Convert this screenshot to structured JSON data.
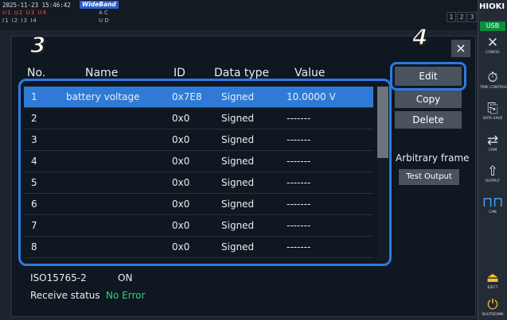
{
  "statusbar": {
    "datetime": "2025-11-23 15:46:42",
    "mode_badge": "WideBand",
    "channel_row1": "U1 U2 U3 U4",
    "channel_row2": "I1 I2 I3 I4",
    "ac_label_top": "A C",
    "ac_label_bottom": "U D",
    "channel_numbers": [
      "1",
      "2",
      "3",
      "4"
    ]
  },
  "dialog": {
    "close_label": "×",
    "step_markers": [
      "3",
      "4"
    ],
    "columns": [
      "No.",
      "Name",
      "ID",
      "Data type",
      "Value"
    ],
    "rows": [
      {
        "no": "1",
        "name": "battery voltage",
        "id": "0x7E8",
        "type": "Signed",
        "value": "10.0000 V"
      },
      {
        "no": "2",
        "name": "",
        "id": "0x0",
        "type": "Signed",
        "value": "-------"
      },
      {
        "no": "3",
        "name": "",
        "id": "0x0",
        "type": "Signed",
        "value": "-------"
      },
      {
        "no": "4",
        "name": "",
        "id": "0x0",
        "type": "Signed",
        "value": "-------"
      },
      {
        "no": "5",
        "name": "",
        "id": "0x0",
        "type": "Signed",
        "value": "-------"
      },
      {
        "no": "6",
        "name": "",
        "id": "0x0",
        "type": "Signed",
        "value": "-------"
      },
      {
        "no": "7",
        "name": "",
        "id": "0x0",
        "type": "Signed",
        "value": "-------"
      },
      {
        "no": "8",
        "name": "",
        "id": "0x0",
        "type": "Signed",
        "value": "-------"
      }
    ],
    "buttons": {
      "edit": "Edit",
      "copy": "Copy",
      "delete": "Delete",
      "test_output": "Test Output"
    },
    "arbitrary_frame_label": "Arbitrary frame",
    "status": {
      "protocol": "ISO15765-2",
      "protocol_state": "ON",
      "receive_label": "Receive status",
      "receive_value": "No Error",
      "receive_color": "#33d17a"
    }
  },
  "sidebar": {
    "brand": "HIOKI",
    "usb": "USB",
    "items": [
      {
        "label": "CONFIG",
        "icon": "tools-icon"
      },
      {
        "label": "TIME CONTROL",
        "icon": "stopwatch-icon"
      },
      {
        "label": "DATA SAVE",
        "icon": "data-save-icon"
      },
      {
        "label": "COM",
        "icon": "com-icon"
      },
      {
        "label": "OUTPUT",
        "icon": "output-icon"
      },
      {
        "label": "CAN",
        "icon": "can-icon"
      },
      {
        "label": "EJECT",
        "icon": "eject-icon"
      },
      {
        "label": "SHUTDOWN",
        "icon": "power-icon"
      }
    ]
  }
}
